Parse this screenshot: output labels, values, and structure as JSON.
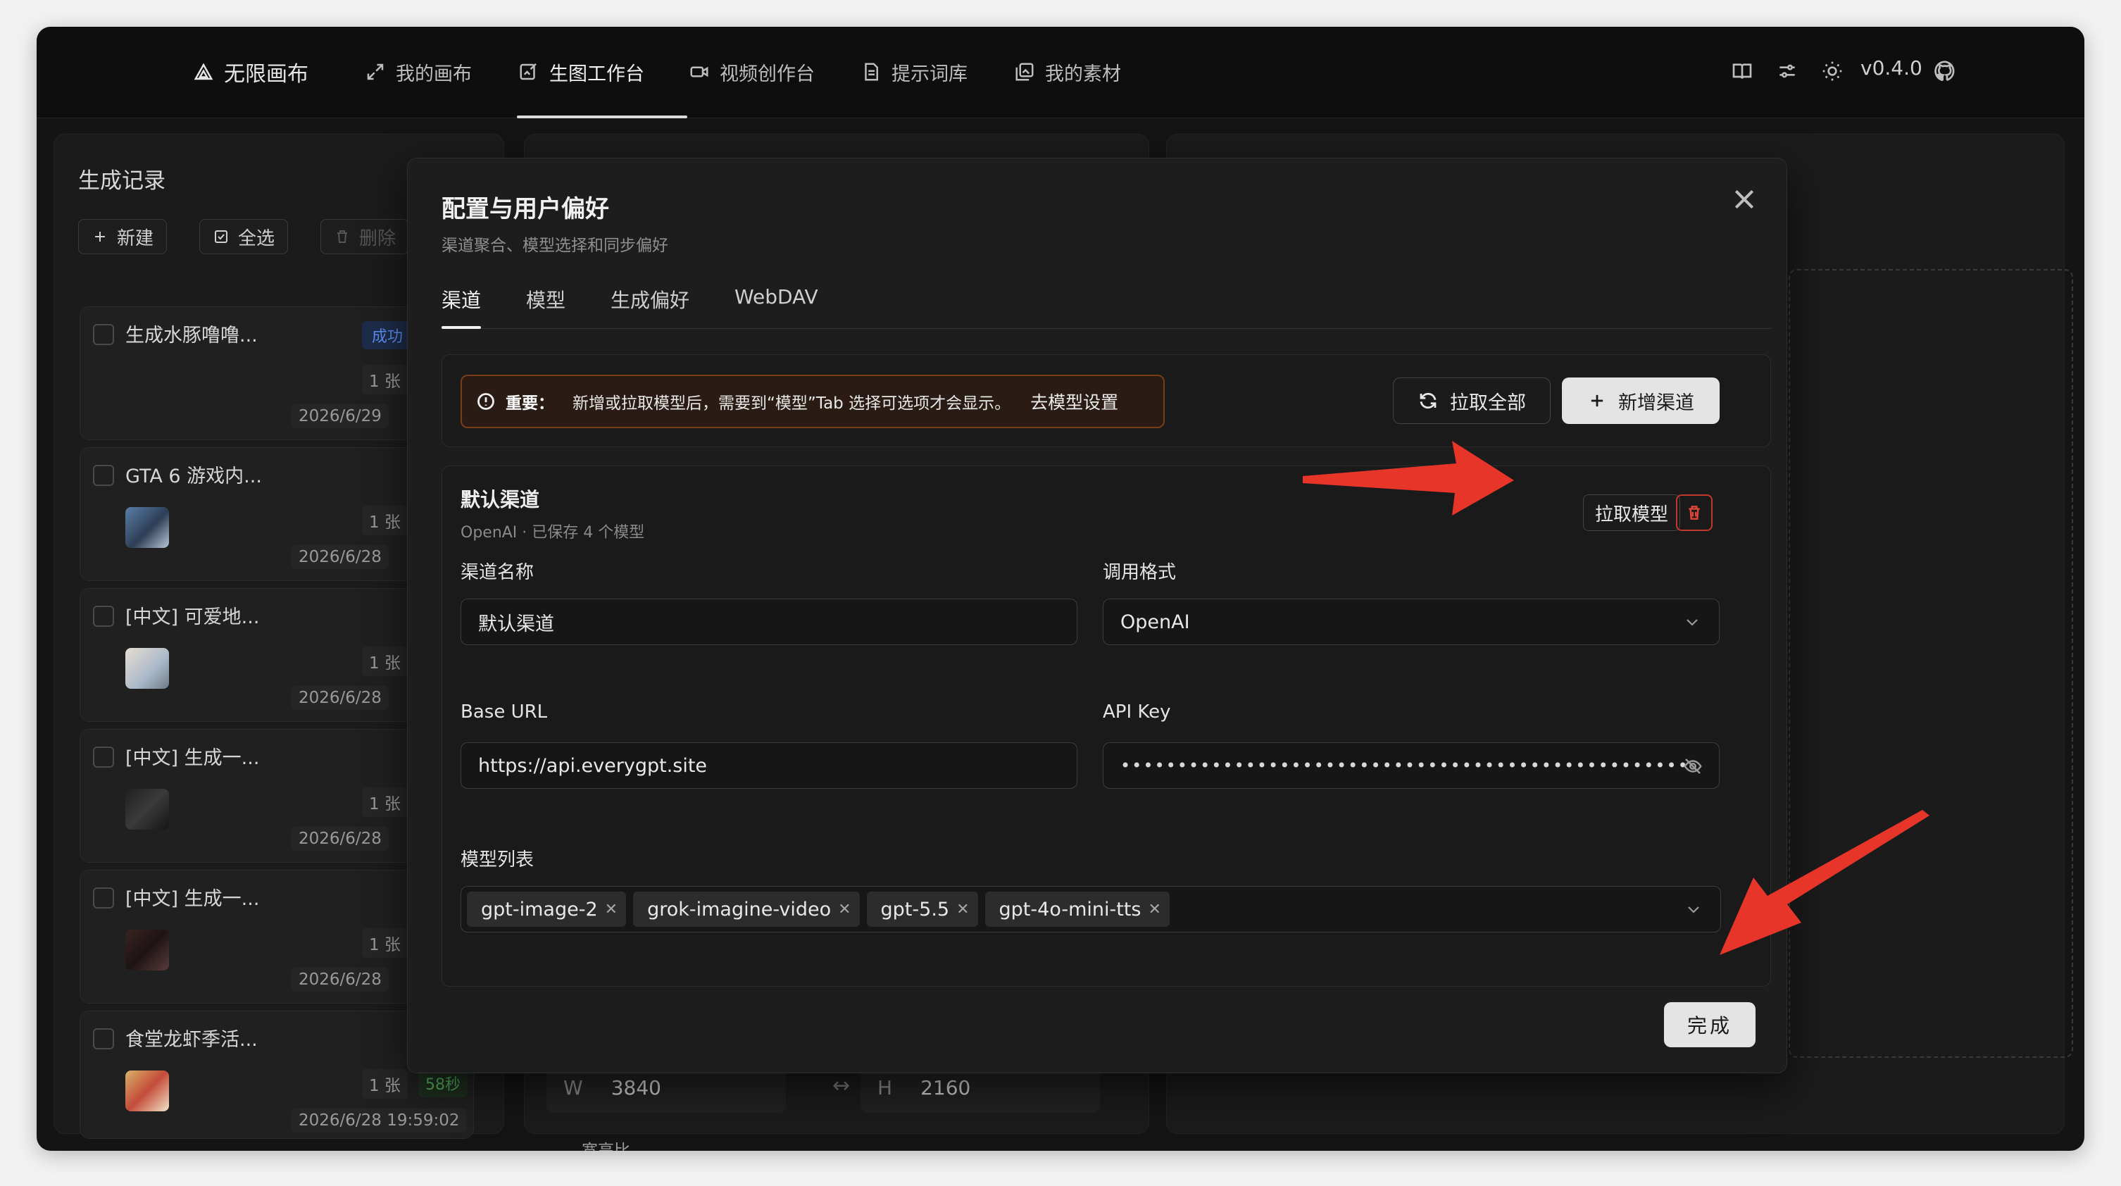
{
  "nav": {
    "brand": "无限画布",
    "items": [
      {
        "label": "我的画布",
        "icon": "expand-arrow-icon"
      },
      {
        "label": "生图工作台",
        "icon": "image-edit-icon"
      },
      {
        "label": "视频创作台",
        "icon": "video-camera-icon"
      },
      {
        "label": "提示词库",
        "icon": "document-icon"
      },
      {
        "label": "我的素材",
        "icon": "gallery-icon"
      }
    ],
    "active_index": 1,
    "right_icons": [
      "book-icon",
      "sliders-icon",
      "sun-icon",
      "github-icon"
    ],
    "version": "v0.4.0"
  },
  "sidebar": {
    "title": "生成记录",
    "tools": {
      "new": "新建",
      "select_all": "全选",
      "delete": "删除"
    },
    "records": [
      {
        "title": "生成水豚噜噜...",
        "badge": "成功",
        "count": "1 张",
        "date": "2026/6/29"
      },
      {
        "title": "GTA 6 游戏内...",
        "count": "1 张",
        "date": "2026/6/28"
      },
      {
        "title": "[中文] 可爱地...",
        "count": "1 张",
        "date": "2026/6/28"
      },
      {
        "title": "[中文] 生成一...",
        "count": "1 张",
        "date": "2026/6/28"
      },
      {
        "title": "[中文] 生成一...",
        "count": "1 张",
        "date": "2026/6/28"
      },
      {
        "title": "食堂龙虾季活...",
        "count": "1 张",
        "time": "58秒",
        "date": "2026/6/28 19:59:02"
      }
    ]
  },
  "workspace": {
    "width_label": "W",
    "width_value": "3840",
    "height_label": "H",
    "height_value": "2160",
    "aspect_label": "宽高比"
  },
  "modal": {
    "title": "配置与用户偏好",
    "subtitle": "渠道聚合、模型选择和同步偏好",
    "tabs": [
      "渠道",
      "模型",
      "生成偏好",
      "WebDAV"
    ],
    "active_tab": 0,
    "notice": {
      "important": "重要：",
      "message": "新增或拉取模型后，需要到“模型”Tab 选择可选项才会显示。",
      "link": "去模型设置"
    },
    "buttons": {
      "fetch_all": "拉取全部",
      "add_channel": "新增渠道",
      "fetch_models": "拉取模型",
      "done": "完成"
    },
    "channel": {
      "title": "默认渠道",
      "subtitle": "OpenAI · 已保存 4 个模型",
      "name_label": "渠道名称",
      "name_value": "默认渠道",
      "format_label": "调用格式",
      "format_value": "OpenAI",
      "base_url_label": "Base URL",
      "base_url_value": "https://api.everygpt.site",
      "api_key_label": "API Key",
      "api_key_value": "••••••••••••••••••••••••••••••••••••••••••••••••••",
      "models_label": "模型列表",
      "models": [
        "gpt-image-2",
        "grok-imagine-video",
        "gpt-5.5",
        "gpt-4o-mini-tts"
      ]
    }
  },
  "colors": {
    "accent_red": "#e8352a",
    "danger": "#e0463a",
    "success_green": "#57b15b",
    "badge_blue": "#5b8def"
  }
}
